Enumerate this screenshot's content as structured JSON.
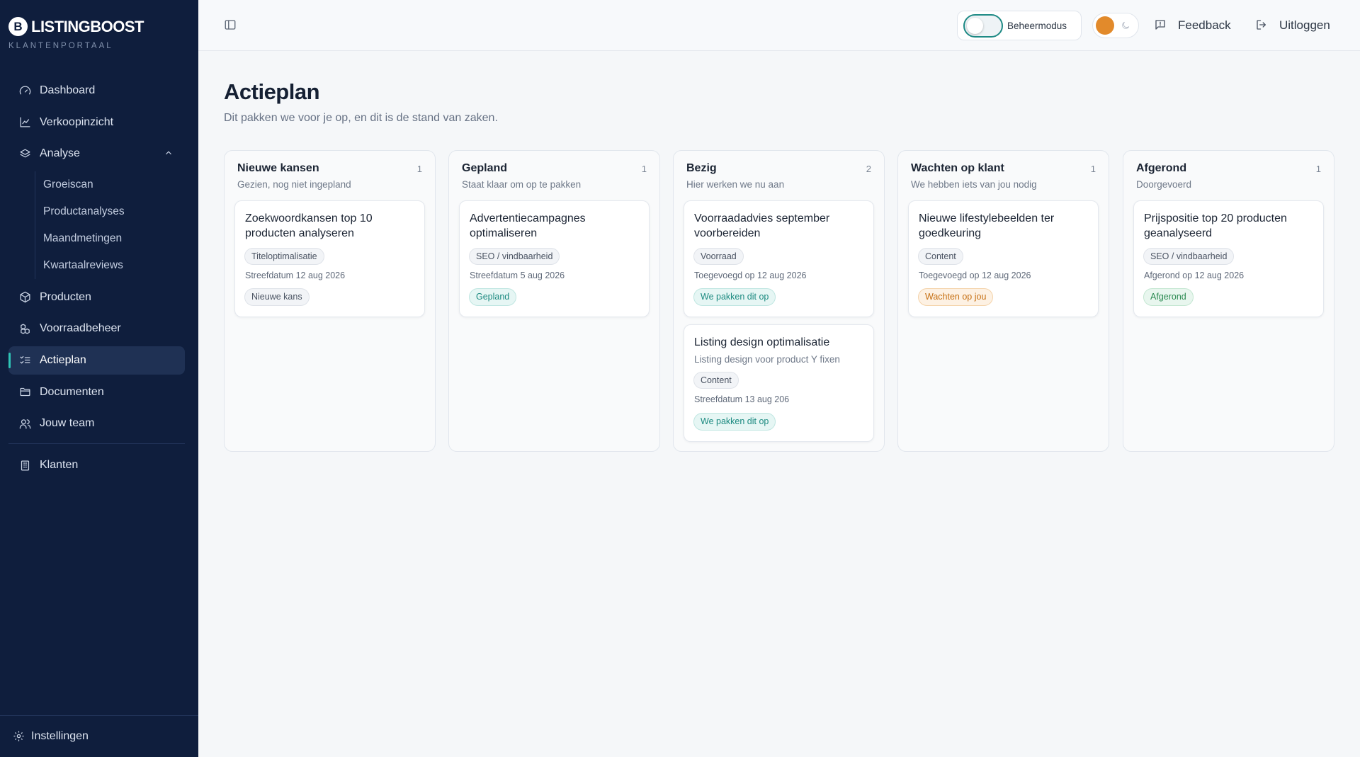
{
  "brand": {
    "mark": "B",
    "name": "LISTINGBOOST",
    "subtitle": "KLANTENPORTAAL"
  },
  "sidebar": {
    "items": [
      {
        "label": "Dashboard",
        "icon": "gauge-icon"
      },
      {
        "label": "Verkoopinzicht",
        "icon": "line-chart-icon"
      },
      {
        "label": "Analyse",
        "icon": "layers-icon",
        "expanded": true,
        "children": [
          "Groeiscan",
          "Productanalyses",
          "Maandmetingen",
          "Kwartaalreviews"
        ]
      },
      {
        "label": "Producten",
        "icon": "package-icon"
      },
      {
        "label": "Voorraadbeheer",
        "icon": "boxes-icon"
      },
      {
        "label": "Actieplan",
        "icon": "list-checks-icon",
        "active": true
      },
      {
        "label": "Documenten",
        "icon": "folder-icon"
      },
      {
        "label": "Jouw team",
        "icon": "users-icon"
      },
      {
        "label": "Klanten",
        "icon": "building-icon"
      }
    ],
    "settings_label": "Instellingen"
  },
  "topbar": {
    "admin_mode_label": "Beheermodus",
    "feedback_label": "Feedback",
    "logout_label": "Uitloggen"
  },
  "page": {
    "title": "Actieplan",
    "subtitle": "Dit pakken we voor je op, en dit is de stand van zaken."
  },
  "columns": [
    {
      "title": "Nieuwe kansen",
      "count": "1",
      "subtitle": "Gezien, nog niet ingepland",
      "cards": [
        {
          "title": "Zoekwoordkansen top 10 producten analyseren",
          "tag": "Titeloptimalisatie",
          "meta": "Streefdatum 12 aug 2026",
          "status": "Nieuwe kans"
        }
      ]
    },
    {
      "title": "Gepland",
      "count": "1",
      "subtitle": "Staat klaar om op te pakken",
      "cards": [
        {
          "title": "Advertentiecampagnes optimaliseren",
          "tag": "SEO / vindbaarheid",
          "meta": "Streefdatum 5 aug 2026",
          "status": "Gepland"
        }
      ]
    },
    {
      "title": "Bezig",
      "count": "2",
      "subtitle": "Hier werken we nu aan",
      "cards": [
        {
          "title": "Voorraadadvies september voorbereiden",
          "tag": "Voorraad",
          "meta": "Toegevoegd op 12 aug 2026",
          "status": "We pakken dit op"
        },
        {
          "title": "Listing design optimalisatie",
          "description": "Listing design voor product Y fixen",
          "tag": "Content",
          "meta": "Streefdatum 13 aug 206",
          "status": "We pakken dit op"
        }
      ]
    },
    {
      "title": "Wachten op klant",
      "count": "1",
      "subtitle": "We hebben iets van jou nodig",
      "cards": [
        {
          "title": "Nieuwe lifestylebeelden ter goedkeuring",
          "tag": "Content",
          "meta": "Toegevoegd op 12 aug 2026",
          "status": "Wachten op jou"
        }
      ]
    },
    {
      "title": "Afgerond",
      "count": "1",
      "subtitle": "Doorgevoerd",
      "cards": [
        {
          "title": "Prijspositie top 20 producten geanalyseerd",
          "tag": "SEO / vindbaarheid",
          "meta": "Afgerond op 12 aug 2026",
          "status": "Afgerond"
        }
      ]
    }
  ],
  "colors": {
    "sidebar_bg": "#0f1e3d",
    "accent_teal": "#1c8a80",
    "status_orange": "#c66f12",
    "status_green": "#2b8a51",
    "sun": "#e28a2b"
  }
}
